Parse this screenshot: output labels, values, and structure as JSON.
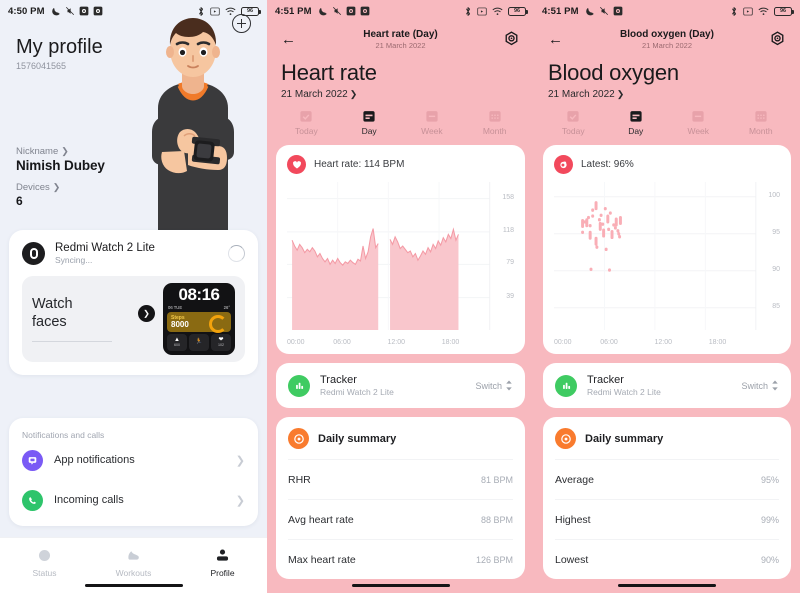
{
  "panels": {
    "profile": {
      "status_bar": {
        "time": "4:50 PM",
        "left_icons": [
          "moon-icon",
          "mute-icon",
          "app-icon",
          "app-icon"
        ],
        "right_icons": [
          "bluetooth-icon",
          "sim-icon",
          "wifi-icon"
        ],
        "battery": "96"
      },
      "title": "My profile",
      "user_id": "1576041565",
      "add_button": "add-icon",
      "nickname_label": "Nickname",
      "nickname_value": "Nimish Dubey",
      "devices_label": "Devices",
      "devices_value": "6",
      "device": {
        "name": "Redmi Watch 2 Lite",
        "status": "Syncing...",
        "sync_icon": "spinner-icon"
      },
      "watch_faces": {
        "title_line1": "Watch",
        "title_line2": "faces",
        "arrow": "chevron-right-icon",
        "preview": {
          "time": "08:16",
          "date": "06 TUE",
          "temperature": "26°",
          "steps_label": "Steps",
          "steps_value": "8000",
          "calories": "600",
          "heart": "102"
        }
      },
      "notifications": {
        "section_title": "Notifications and calls",
        "items": [
          {
            "label": "App notifications",
            "icon": "chat-bubble-icon",
            "color": "#7a5af5"
          },
          {
            "label": "Incoming calls",
            "icon": "phone-icon",
            "color": "#2ec46b"
          }
        ]
      },
      "tabs": [
        {
          "label": "Status",
          "icon": "circle-icon",
          "active": false
        },
        {
          "label": "Workouts",
          "icon": "shoe-icon",
          "active": false
        },
        {
          "label": "Profile",
          "icon": "person-icon",
          "active": true
        }
      ]
    },
    "heart_rate": {
      "status_bar": {
        "time": "4:51 PM",
        "battery": "96"
      },
      "nav_title": "Heart rate (Day)",
      "nav_subtitle": "21 March 2022",
      "back_icon": "back-arrow-icon",
      "settings_icon": "gear-icon",
      "page_title": "Heart rate",
      "date": "21 March 2022",
      "segments": [
        {
          "label": "Today",
          "icon": "calendar-check-icon",
          "active": false
        },
        {
          "label": "Day",
          "icon": "calendar-day-icon",
          "active": true
        },
        {
          "label": "Week",
          "icon": "calendar-week-icon",
          "active": false
        },
        {
          "label": "Month",
          "icon": "calendar-month-icon",
          "active": false
        }
      ],
      "chart_header": "Heart rate: 114 BPM",
      "chart_header_icon": "heart-icon",
      "tracker": {
        "title": "Tracker",
        "device": "Redmi Watch 2 Lite",
        "switch_label": "Switch",
        "icon": "bar-chart-icon"
      },
      "summary": {
        "title": "Daily summary",
        "icon": "target-icon",
        "rows": [
          {
            "key": "RHR",
            "value": "81 BPM"
          },
          {
            "key": "Avg heart rate",
            "value": "88 BPM"
          },
          {
            "key": "Max heart rate",
            "value": "126 BPM"
          }
        ]
      }
    },
    "blood_oxygen": {
      "status_bar": {
        "time": "4:51 PM",
        "battery": "96"
      },
      "nav_title": "Blood oxygen (Day)",
      "nav_subtitle": "21 March 2022",
      "back_icon": "back-arrow-icon",
      "settings_icon": "gear-icon",
      "page_title": "Blood oxygen",
      "date": "21 March 2022",
      "segments": [
        {
          "label": "Today",
          "icon": "calendar-check-icon",
          "active": false
        },
        {
          "label": "Day",
          "icon": "calendar-day-icon",
          "active": true
        },
        {
          "label": "Week",
          "icon": "calendar-week-icon",
          "active": false
        },
        {
          "label": "Month",
          "icon": "calendar-month-icon",
          "active": false
        }
      ],
      "chart_header": "Latest: 96%",
      "chart_header_icon": "blood-drop-icon",
      "tracker": {
        "title": "Tracker",
        "device": "Redmi Watch 2 Lite",
        "switch_label": "Switch",
        "icon": "bar-chart-icon"
      },
      "summary": {
        "title": "Daily summary",
        "icon": "target-icon",
        "rows": [
          {
            "key": "Average",
            "value": "95%"
          },
          {
            "key": "Highest",
            "value": "99%"
          },
          {
            "key": "Lowest",
            "value": "90%"
          }
        ]
      }
    }
  },
  "colors": {
    "pink_bg": "#f8b9bf",
    "chart_pink": "#f5a0aa",
    "chart_fill": "#f9c8cd",
    "profile_bg": "#eef1f8",
    "accent_red": "#f2495c",
    "green": "#3fcb62",
    "orange": "#f97b2e"
  },
  "chart_data": [
    {
      "id": "heart-rate-chart",
      "type": "area",
      "title": "Heart rate: 114 BPM",
      "xlabel": "",
      "ylabel": "BPM",
      "ylim": [
        0,
        178
      ],
      "yticks": [
        39,
        79,
        118,
        158
      ],
      "xticks": [
        "00:00",
        "06:00",
        "12:00",
        "18:00"
      ],
      "xlim": [
        0,
        24
      ],
      "grid": true,
      "legend": "none",
      "series": [
        {
          "name": "Heart rate",
          "gap_between_segments": true,
          "x": [
            0.6,
            0.9,
            1.2,
            1.5,
            1.8,
            2.1,
            2.4,
            2.7,
            3.0,
            3.3,
            3.6,
            3.9,
            4.2,
            4.5,
            4.8,
            5.1,
            5.4,
            5.7,
            6.0,
            6.3,
            6.6,
            6.9,
            7.2,
            7.5,
            7.8,
            8.1,
            8.4,
            8.7,
            9.0,
            9.3,
            9.6,
            9.9,
            10.2,
            10.5,
            10.8,
            12.2,
            12.5,
            12.8,
            13.1,
            13.4,
            13.7,
            14.0,
            14.3,
            14.6,
            14.9,
            15.2,
            15.5,
            15.8,
            16.1,
            16.4,
            16.7,
            17.0,
            17.3,
            17.6,
            17.9,
            18.2,
            18.5,
            18.8,
            19.1,
            19.4,
            19.7,
            20.0,
            20.3
          ],
          "y": [
            108,
            101,
            96,
            103,
            99,
            93,
            97,
            94,
            99,
            95,
            88,
            92,
            86,
            82,
            86,
            79,
            84,
            80,
            86,
            81,
            78,
            82,
            80,
            84,
            81,
            79,
            85,
            83,
            101,
            86,
            94,
            112,
            122,
            99,
            104,
            109,
            103,
            112,
            106,
            98,
            101,
            97,
            93,
            95,
            88,
            92,
            84,
            89,
            95,
            91,
            99,
            94,
            103,
            98,
            107,
            102,
            111,
            106,
            115,
            110,
            121,
            108,
            115
          ]
        }
      ]
    },
    {
      "id": "blood-oxygen-chart",
      "type": "scatter",
      "title": "Latest: 96%",
      "xlabel": "",
      "ylabel": "SpO2 %",
      "ylim": [
        82,
        102
      ],
      "yticks": [
        85,
        90,
        95,
        100
      ],
      "xticks": [
        "00:00",
        "06:00",
        "12:00",
        "18:00"
      ],
      "xlim": [
        0,
        24
      ],
      "grid": true,
      "legend": "none",
      "points": [
        {
          "x": 3.4,
          "y": 96.4
        },
        {
          "x": 3.4,
          "y": 95.2
        },
        {
          "x": 3.7,
          "y": 96.6
        },
        {
          "x": 3.9,
          "y": 96.5
        },
        {
          "x": 4.1,
          "y": 97.2
        },
        {
          "x": 4.3,
          "y": 96.1
        },
        {
          "x": 4.3,
          "y": 94.8
        },
        {
          "x": 4.6,
          "y": 98.2
        },
        {
          "x": 4.6,
          "y": 97.4
        },
        {
          "x": 5.0,
          "y": 98.8
        },
        {
          "x": 5.1,
          "y": 93.2
        },
        {
          "x": 5.4,
          "y": 96.9
        },
        {
          "x": 5.5,
          "y": 96.0
        },
        {
          "x": 5.6,
          "y": 97.5
        },
        {
          "x": 5.8,
          "y": 96.3
        },
        {
          "x": 5.9,
          "y": 95.1
        },
        {
          "x": 6.1,
          "y": 98.4
        },
        {
          "x": 6.2,
          "y": 92.9
        },
        {
          "x": 6.4,
          "y": 97.0
        },
        {
          "x": 6.5,
          "y": 95.6
        },
        {
          "x": 6.7,
          "y": 97.8
        },
        {
          "x": 6.9,
          "y": 94.9
        },
        {
          "x": 7.1,
          "y": 96.2
        },
        {
          "x": 7.3,
          "y": 95.8
        },
        {
          "x": 7.4,
          "y": 96.6
        },
        {
          "x": 7.6,
          "y": 95.4
        },
        {
          "x": 7.8,
          "y": 94.6
        },
        {
          "x": 7.9,
          "y": 96.8
        },
        {
          "x": 4.4,
          "y": 90.2
        },
        {
          "x": 6.6,
          "y": 90.1
        },
        {
          "x": 5.0,
          "y": 94.0
        },
        {
          "x": 7.7,
          "y": 95.0
        }
      ]
    }
  ]
}
